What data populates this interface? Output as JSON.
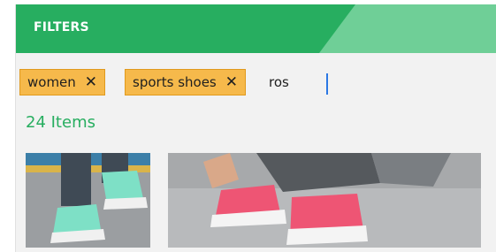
{
  "header": {
    "title": "FILTERS"
  },
  "filters": {
    "chips": [
      {
        "label": "women",
        "remove": "✕"
      },
      {
        "label": "sports shoes",
        "remove": "✕"
      }
    ],
    "search_value": "ros"
  },
  "results": {
    "count_text": "24 Items"
  },
  "products": [
    {
      "image": "teal-sneakers-photo"
    },
    {
      "image": "pink-sneakers-photo"
    }
  ],
  "colors": {
    "header_dark": "#27ae60",
    "header_light": "#6fcf97",
    "chip_bg": "#f6b94b",
    "accent_text": "#27ae60"
  }
}
